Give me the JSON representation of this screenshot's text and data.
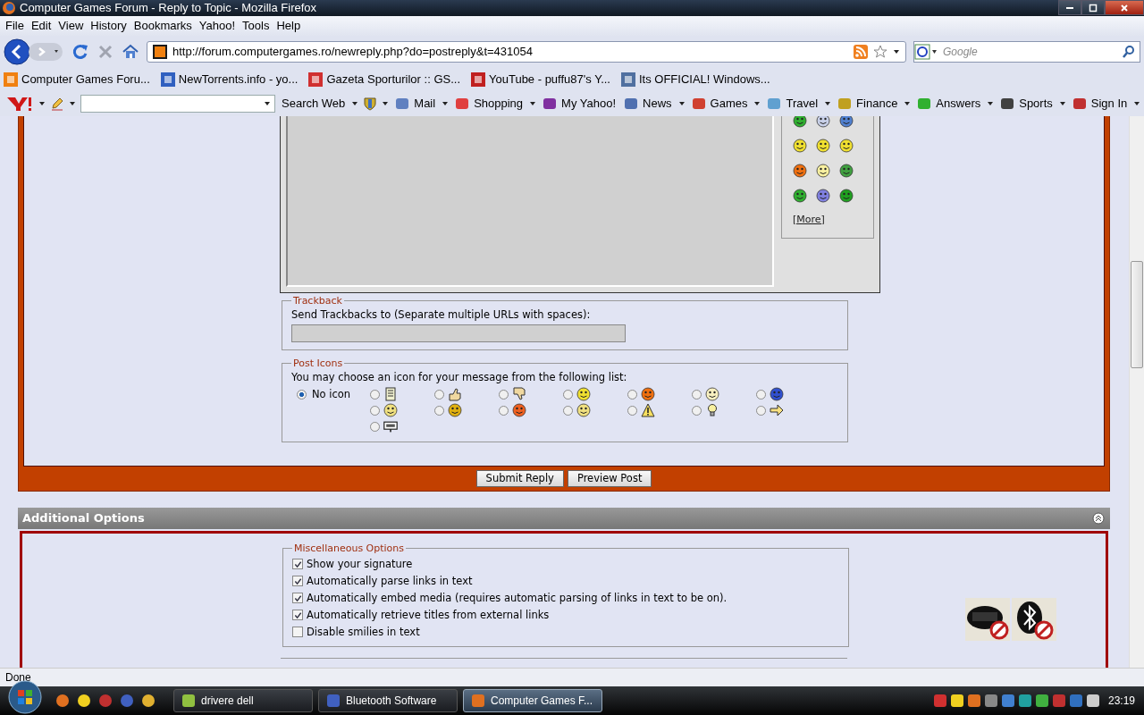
{
  "window": {
    "title": "Computer Games Forum - Reply to Topic - Mozilla Firefox"
  },
  "menu": [
    "File",
    "Edit",
    "View",
    "History",
    "Bookmarks",
    "Yahoo!",
    "Tools",
    "Help"
  ],
  "address_bar": {
    "value": "http://forum.computergames.ro/newreply.php?do=postreply&t=431054"
  },
  "search": {
    "placeholder": "Google"
  },
  "bookmarks": [
    "Computer Games Foru...",
    "NewTorrents.info - yo...",
    "Gazeta Sporturilor :: GS...",
    "YouTube - puffu87's Y...",
    "Its OFFICIAL! Windows..."
  ],
  "yahoo_toolbar": {
    "search_button": "Search Web",
    "items": [
      "Mail",
      "Shopping",
      "My Yahoo!",
      "News",
      "Games",
      "Travel",
      "Finance",
      "Answers",
      "Sports",
      "Sign In"
    ]
  },
  "smilies": {
    "more_link": "[More]"
  },
  "trackback": {
    "legend": "Trackback",
    "label": "Send Trackbacks to (Separate multiple URLs with spaces):"
  },
  "post_icons": {
    "legend": "Post Icons",
    "instruction": "You may choose an icon for your message from the following list:",
    "options": [
      {
        "label": "No icon",
        "selected": true
      },
      {
        "selected": false
      },
      {
        "selected": false
      },
      {
        "selected": false
      },
      {
        "selected": false
      },
      {
        "selected": false
      },
      {
        "selected": false
      },
      {
        "selected": false
      },
      {
        "selected": false
      },
      {
        "selected": false
      },
      {
        "selected": false
      },
      {
        "selected": false
      },
      {
        "selected": false
      },
      {
        "selected": false
      },
      {
        "selected": false
      },
      {
        "selected": false
      }
    ]
  },
  "buttons": [
    "Submit Reply",
    "Preview Post"
  ],
  "additional_options": {
    "title": "Additional Options",
    "misc": {
      "legend": "Miscellaneous Options",
      "options": [
        {
          "label": "Show your signature",
          "checked": true
        },
        {
          "label": "Automatically parse links in text",
          "checked": true
        },
        {
          "label": "Automatically embed media (requires automatic parsing of links in text to be on).",
          "checked": true
        },
        {
          "label": "Automatically retrieve titles from external links",
          "checked": true
        },
        {
          "label": "Disable smilies in text",
          "checked": false
        }
      ]
    }
  },
  "status_bar": {
    "text": "Done"
  },
  "taskbar": {
    "tasks": [
      {
        "label": "drivere dell",
        "selected": false
      },
      {
        "label": "Bluetooth Software",
        "selected": false
      },
      {
        "label": "Computer Games F...",
        "selected": true
      }
    ],
    "clock": "23:19"
  }
}
